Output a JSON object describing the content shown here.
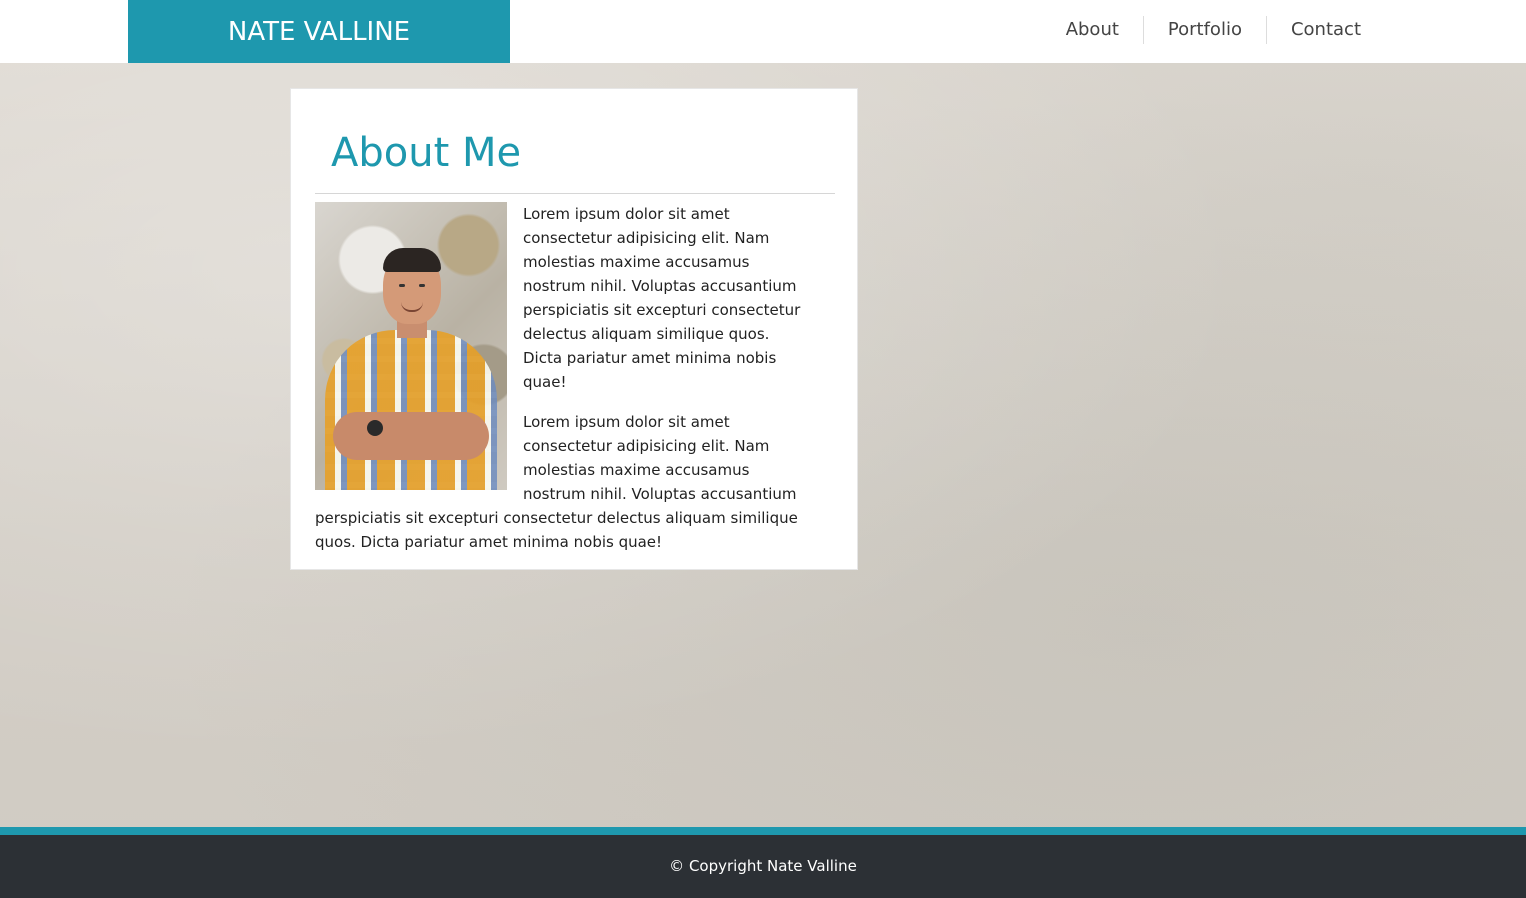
{
  "header": {
    "brand": "NATE VALLINE",
    "nav": [
      "About",
      "Portfolio",
      "Contact"
    ]
  },
  "about": {
    "title": "About Me",
    "photo_icon": "portrait-photo",
    "paragraphs": [
      "Lorem ipsum dolor sit amet consectetur adipisicing elit. Nam molestias maxime accusamus nostrum nihil. Voluptas accusantium perspiciatis sit excepturi consectetur delectus aliquam similique quos. Dicta pariatur amet minima nobis quae!",
      "Lorem ipsum dolor sit amet consectetur adipisicing elit. Nam molestias maxime accusamus nostrum nihil. Voluptas accusantium perspiciatis sit excepturi consectetur delectus aliquam similique quos. Dicta pariatur amet minima nobis quae!"
    ]
  },
  "footer": {
    "copyright": "© Copyright Nate Valline"
  },
  "colors": {
    "accent": "#1e98ae",
    "footer_bg": "#2c3035"
  }
}
